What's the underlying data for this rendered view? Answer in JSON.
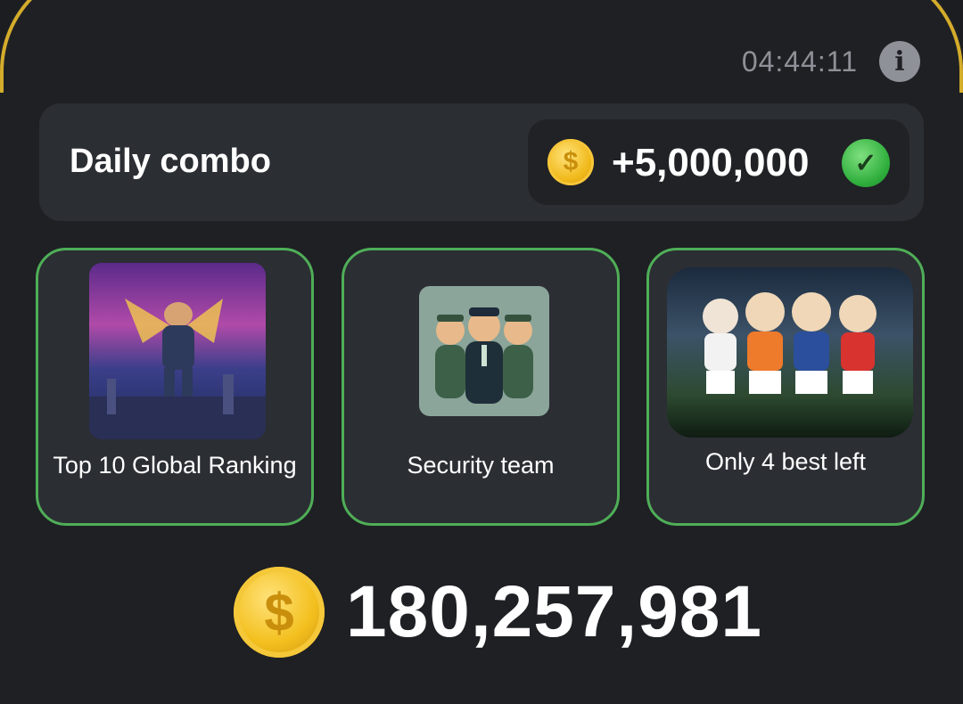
{
  "header": {
    "timer": "04:44:11"
  },
  "combo": {
    "title": "Daily combo",
    "reward": "+5,000,000"
  },
  "cards": [
    {
      "label": "Top 10 Global Ranking"
    },
    {
      "label": "Security team"
    },
    {
      "label": "Only 4 best left"
    }
  ],
  "balance": {
    "value": "180,257,981"
  },
  "colors": {
    "accent_gold": "#f3c01f",
    "success_green": "#4fae57",
    "card_bg": "#2b2e33"
  },
  "icons": [
    "info-icon",
    "coin-icon",
    "check-icon"
  ]
}
